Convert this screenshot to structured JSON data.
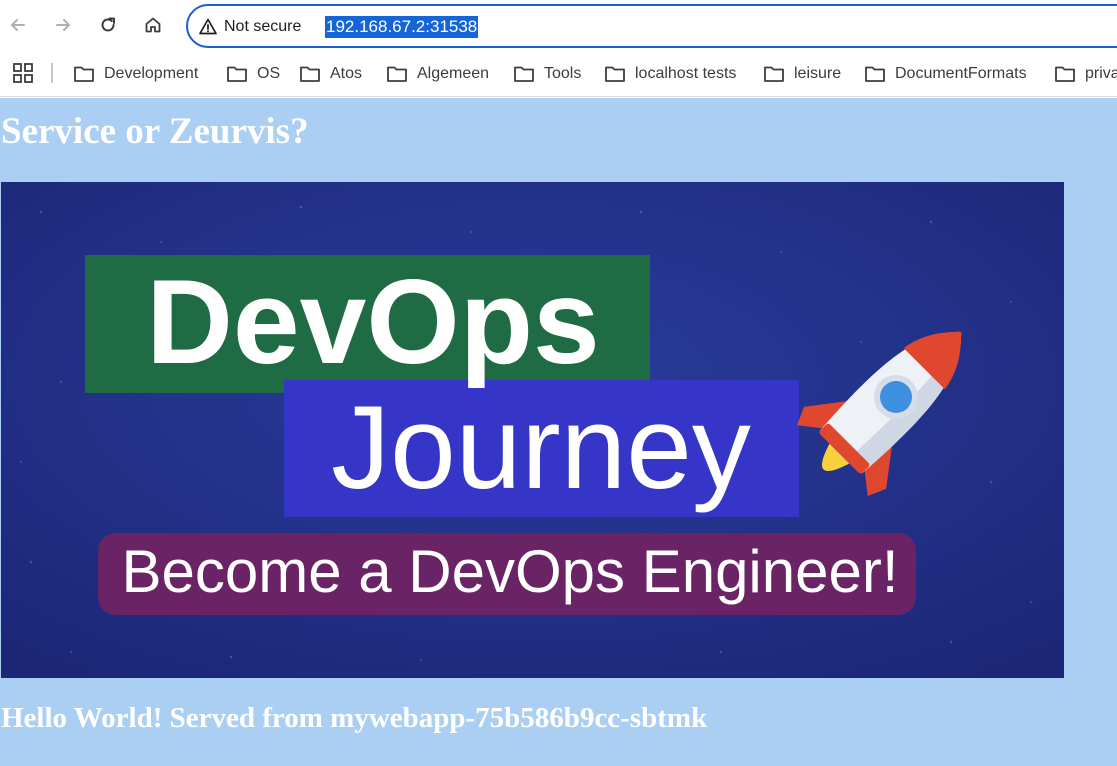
{
  "browser": {
    "security_label": "Not secure",
    "url": "192.168.67.2:31538",
    "icons": {
      "back": "arrow-left-icon",
      "forward": "arrow-right-icon",
      "reload": "reload-icon",
      "home": "home-icon",
      "security": "warning-triangle-icon",
      "apps": "apps-grid-icon",
      "folder": "folder-icon"
    }
  },
  "bookmarks": [
    {
      "label": "Development"
    },
    {
      "label": "OS"
    },
    {
      "label": "Atos"
    },
    {
      "label": "Algemeen"
    },
    {
      "label": "Tools"
    },
    {
      "label": "localhost tests"
    },
    {
      "label": "leisure"
    },
    {
      "label": "DocumentFormats"
    },
    {
      "label": "priva"
    }
  ],
  "page": {
    "title": "Service or Zeurvis?",
    "banner": {
      "line1": "DevOps",
      "line2": "Journey",
      "line3": "Become a DevOps Engineer!",
      "icon": "rocket-icon"
    },
    "footer": "Hello World! Served from mywebapp-75b586b9cc-sbtmk"
  },
  "colors": {
    "page_background": "#abcff2",
    "banner_background": "#1f2f85",
    "green_box": "#1e6b44",
    "blue_box": "#3535c8",
    "purple_box": "#6a2466",
    "url_selection": "#1565d8"
  }
}
